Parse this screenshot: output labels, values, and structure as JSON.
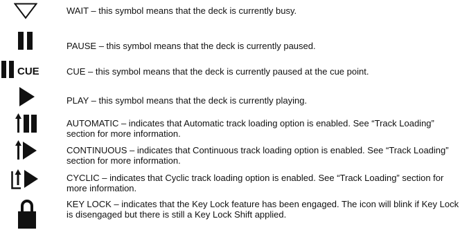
{
  "legend": {
    "items": [
      {
        "icon": "wait-icon",
        "text": "WAIT – this symbol means that the deck is currently busy."
      },
      {
        "icon": "pause-icon",
        "text": "PAUSE – this symbol means that the deck is currently paused."
      },
      {
        "icon": "pause-cue-icon",
        "icon_label": "CUE",
        "text": "CUE – this symbol means that the deck is currently paused at the cue point."
      },
      {
        "icon": "play-icon",
        "text": "PLAY – this symbol means that the deck is currently playing."
      },
      {
        "icon": "automatic-loading-icon",
        "text": "AUTOMATIC – indicates that Automatic track loading option is enabled.  See “Track Loading” section for more information."
      },
      {
        "icon": "continuous-loading-icon",
        "text": "CONTINUOUS – indicates that Continuous track loading option is enabled.  See “Track Loading” section for more information."
      },
      {
        "icon": "cyclic-loading-icon",
        "text": "CYCLIC – indicates that Cyclic track loading option is enabled.  See “Track Loading” section for more information."
      },
      {
        "icon": "lock-icon",
        "text": "KEY LOCK – indicates that the Key Lock feature has been engaged.  The icon will blink if Key Lock is disengaged but there is still a Key Lock Shift applied."
      }
    ]
  }
}
